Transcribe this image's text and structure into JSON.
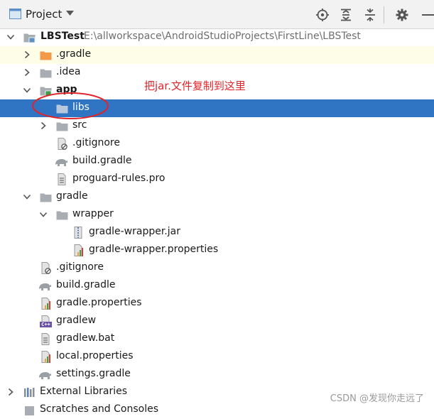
{
  "toolbar": {
    "title": "Project",
    "buttons": [
      "locate-icon",
      "expand-all-icon",
      "collapse-all-icon",
      "gear-icon",
      "hide-icon"
    ]
  },
  "tree": {
    "root_name": "LBSTest",
    "root_path": "E:\\allworkspace\\AndroidStudioProjects\\FirstLine\\LBSTest",
    "gradle_dir": ".gradle",
    "idea_dir": ".idea",
    "app_dir": "app",
    "libs_dir": "libs",
    "src_dir": "src",
    "app_gitignore": ".gitignore",
    "app_build_gradle": "build.gradle",
    "proguard": "proguard-rules.pro",
    "gradle_folder": "gradle",
    "wrapper_dir": "wrapper",
    "wrapper_jar": "gradle-wrapper.jar",
    "wrapper_props": "gradle-wrapper.properties",
    "root_gitignore": ".gitignore",
    "root_build_gradle": "build.gradle",
    "gradle_properties": "gradle.properties",
    "gradlew": "gradlew",
    "gradlew_bat": "gradlew.bat",
    "local_properties": "local.properties",
    "settings_gradle": "settings.gradle",
    "external_libraries": "External Libraries",
    "scratches": "Scratches and Consoles"
  },
  "annotation": {
    "text": "把jar.文件复制到这里",
    "color": "#e0242a"
  },
  "watermark": "CSDN @发现你走远了",
  "colors": {
    "selection": "#2f75c4",
    "highlight_row": "#fdfde8",
    "folder": "#a8adb3",
    "gradle_folder": "#f19a4a"
  }
}
